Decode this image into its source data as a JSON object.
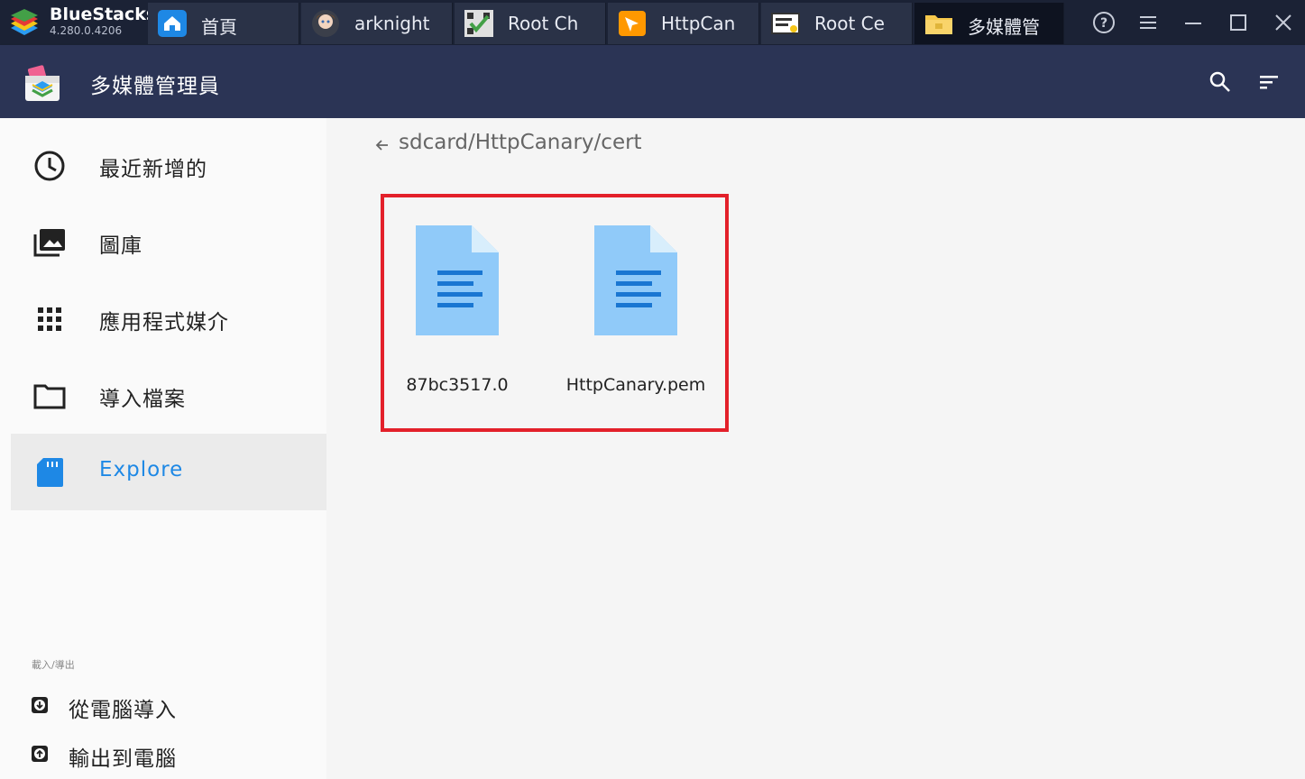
{
  "bluestacks": {
    "brand": "BlueStacks",
    "version": "4.280.0.4206"
  },
  "tabs": [
    {
      "label": "首頁",
      "icon": "home-icon"
    },
    {
      "label": "arknight",
      "icon": "arknights-game-icon"
    },
    {
      "label": "Root Ch",
      "icon": "root-checker-icon"
    },
    {
      "label": "HttpCan",
      "icon": "httpcanary-icon"
    },
    {
      "label": "Root Ce",
      "icon": "root-certificate-icon"
    },
    {
      "label": "多媒體管",
      "icon": "folder-icon"
    }
  ],
  "window_controls": [
    "help-icon",
    "menu-icon",
    "minimize-icon",
    "maximize-icon",
    "close-icon"
  ],
  "app": {
    "title": "多媒體管理員",
    "actions": [
      "search-icon",
      "sort-icon"
    ]
  },
  "sidebar": {
    "items": [
      {
        "label": "最近新增的",
        "icon": "clock-icon"
      },
      {
        "label": "圖庫",
        "icon": "gallery-icon"
      },
      {
        "label": "應用程式媒介",
        "icon": "apps-grid-icon"
      },
      {
        "label": "導入檔案",
        "icon": "folder-outline-icon"
      },
      {
        "label": "Explore",
        "icon": "sd-card-icon",
        "active": true
      }
    ],
    "section_label": "載入/導出",
    "actions": [
      {
        "label": "從電腦導入",
        "icon": "import-icon"
      },
      {
        "label": "輸出到電腦",
        "icon": "export-icon"
      }
    ]
  },
  "explorer": {
    "path": "sdcard/HttpCanary/cert",
    "files": [
      {
        "name": "87bc3517.0",
        "icon": "document-icon"
      },
      {
        "name": "HttpCanary.pem",
        "icon": "document-icon"
      }
    ],
    "highlight_color": "#e3202a"
  },
  "colors": {
    "titlebar": "#1b2235",
    "appbar": "#2b3455",
    "accent": "#1e88e5",
    "file_icon": "#90caf9",
    "file_lines": "#1976d2"
  }
}
